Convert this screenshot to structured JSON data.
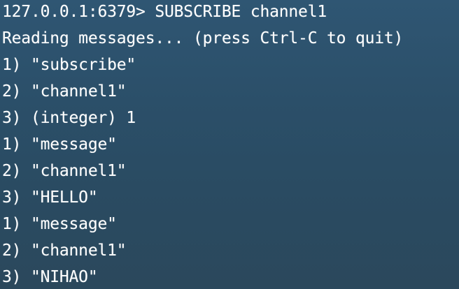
{
  "terminal": {
    "lines": [
      "127.0.0.1:6379> SUBSCRIBE channel1",
      "Reading messages... (press Ctrl-C to quit)",
      "1) \"subscribe\"",
      "2) \"channel1\"",
      "3) (integer) 1",
      "1) \"message\"",
      "2) \"channel1\"",
      "3) \"HELLO\"",
      "1) \"message\"",
      "2) \"channel1\"",
      "3) \"NIHAO\""
    ]
  }
}
